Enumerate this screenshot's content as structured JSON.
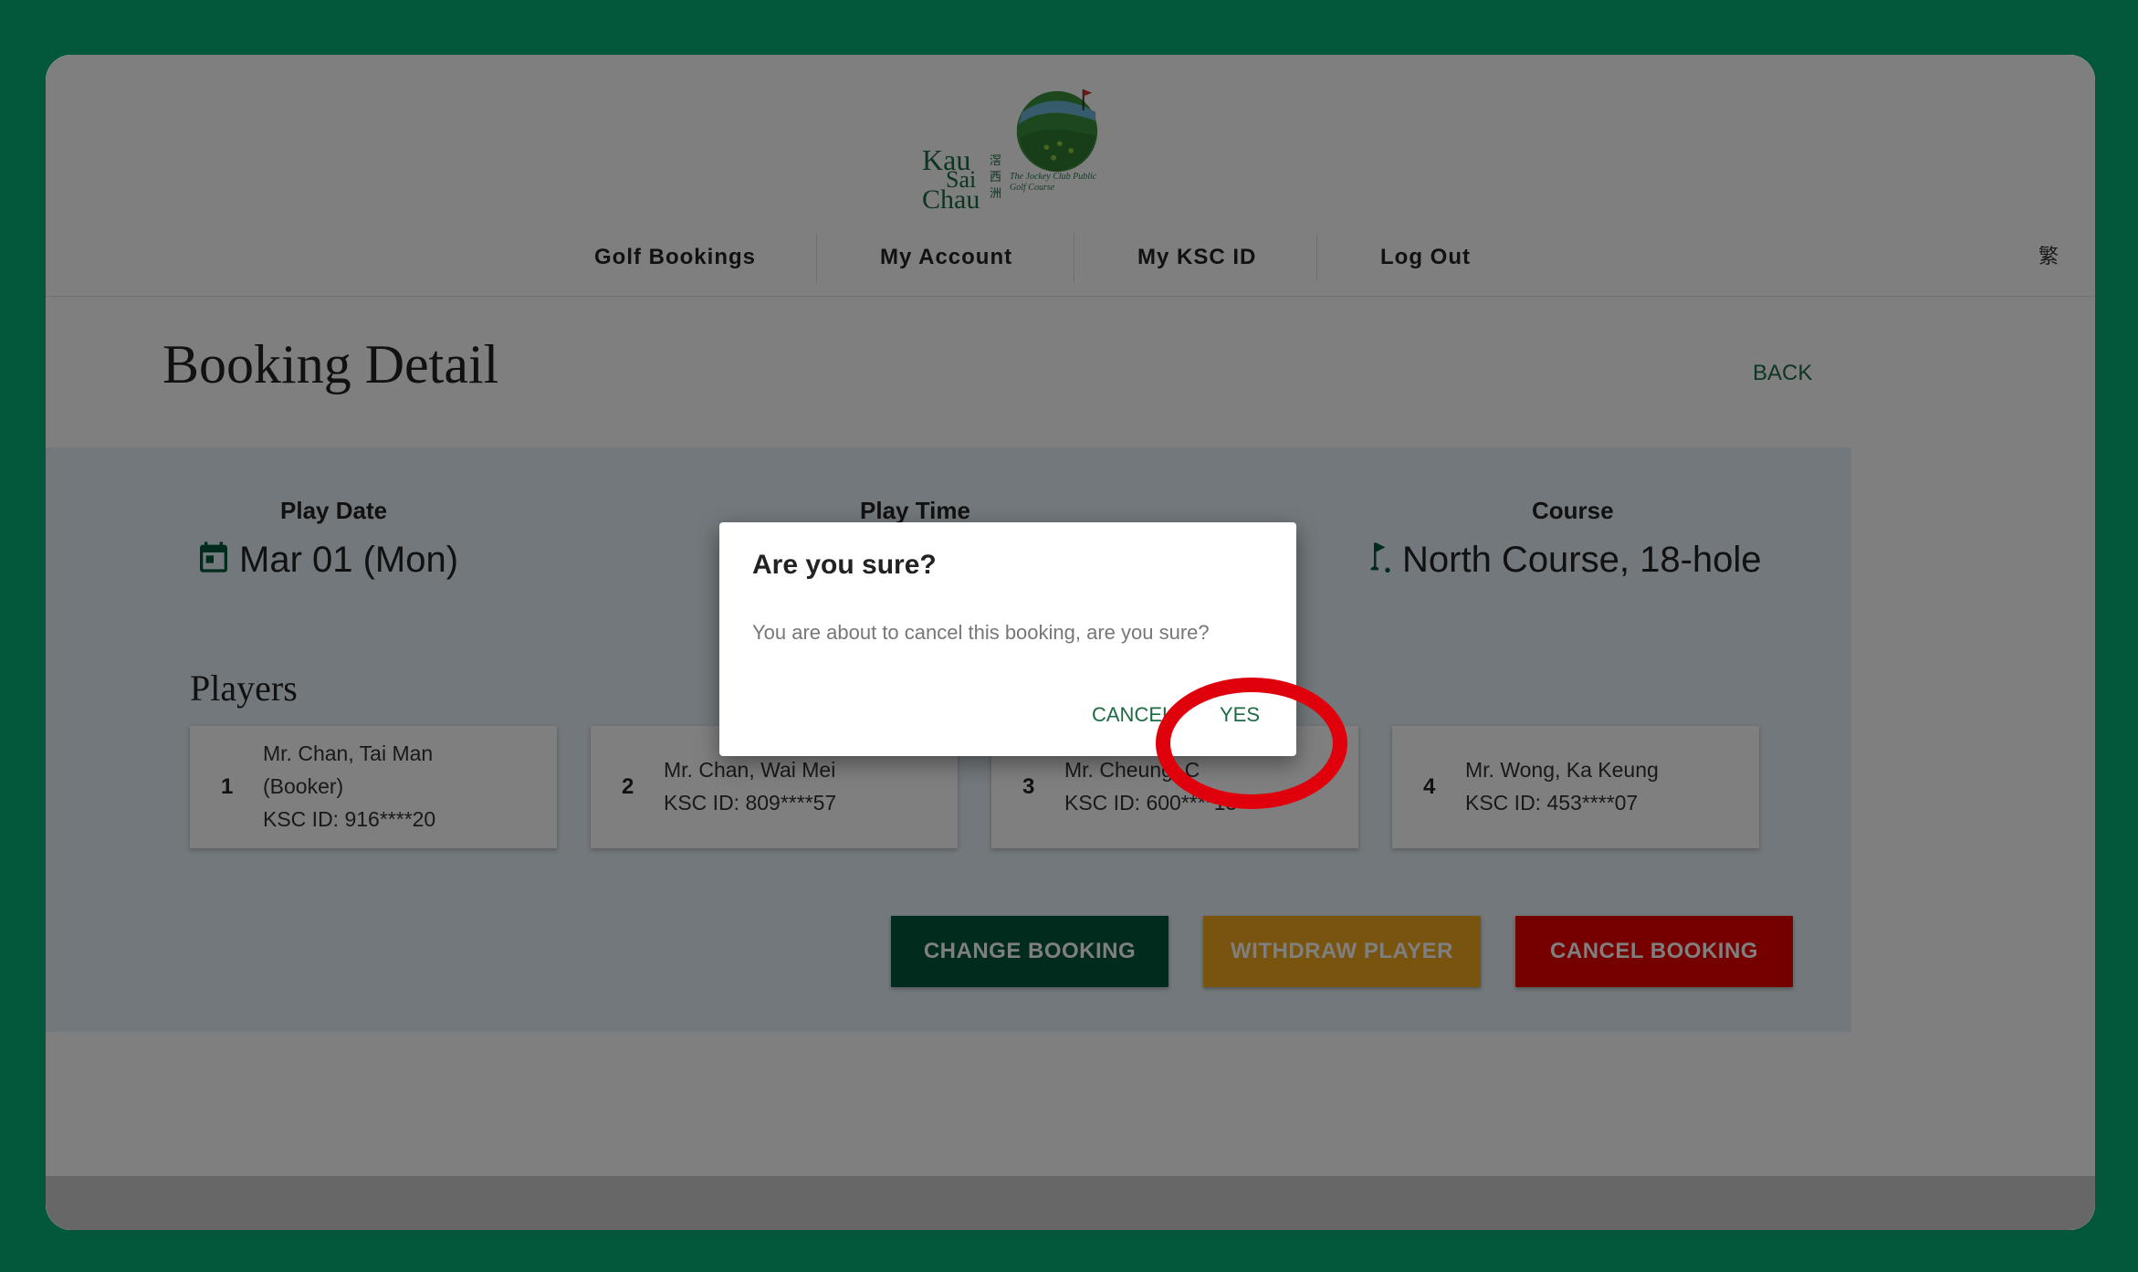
{
  "header": {
    "logo_line1": "Kau",
    "logo_line2": "Sai",
    "logo_line3": "Chau",
    "logo_zh1": "滘",
    "logo_zh2": "西",
    "logo_zh3": "洲",
    "logo_sub": "The Jockey Club Public Golf Course"
  },
  "nav": {
    "items": [
      {
        "label": "Golf Bookings"
      },
      {
        "label": "My Account"
      },
      {
        "label": "My KSC ID"
      },
      {
        "label": "Log Out"
      }
    ],
    "language": "繁"
  },
  "page": {
    "title": "Booking Detail",
    "back_label": "BACK"
  },
  "booking": {
    "play_date_label": "Play Date",
    "play_date": "Mar 01 (Mon)",
    "play_time_label": "Play Time",
    "course_label": "Course",
    "course": "North Course, 18-hole"
  },
  "players": {
    "title": "Players",
    "list": [
      {
        "num": "1",
        "name": "Mr. Chan, Tai Man",
        "role": "(Booker)",
        "ksc": "KSC ID: 916****20"
      },
      {
        "num": "2",
        "name": "Mr. Chan, Wai Mei",
        "ksc": "KSC ID: 809****57"
      },
      {
        "num": "3",
        "name": "Mr. Cheung, C",
        "ksc": "KSC ID: 600****13"
      },
      {
        "num": "4",
        "name": "Mr. Wong, Ka Keung",
        "ksc": "KSC ID: 453****07"
      }
    ]
  },
  "actions": {
    "change": "CHANGE BOOKING",
    "withdraw": "WITHDRAW PLAYER",
    "cancel": "CANCEL BOOKING"
  },
  "dialog": {
    "title": "Are you sure?",
    "message": "You are about to cancel this booking, are you sure?",
    "cancel_label": "CANCEL",
    "yes_label": "YES"
  },
  "colors": {
    "brand_green": "#03573a",
    "withdraw_amber": "#f0a81c",
    "cancel_red": "#e80000",
    "highlight_red": "#e0000c"
  }
}
